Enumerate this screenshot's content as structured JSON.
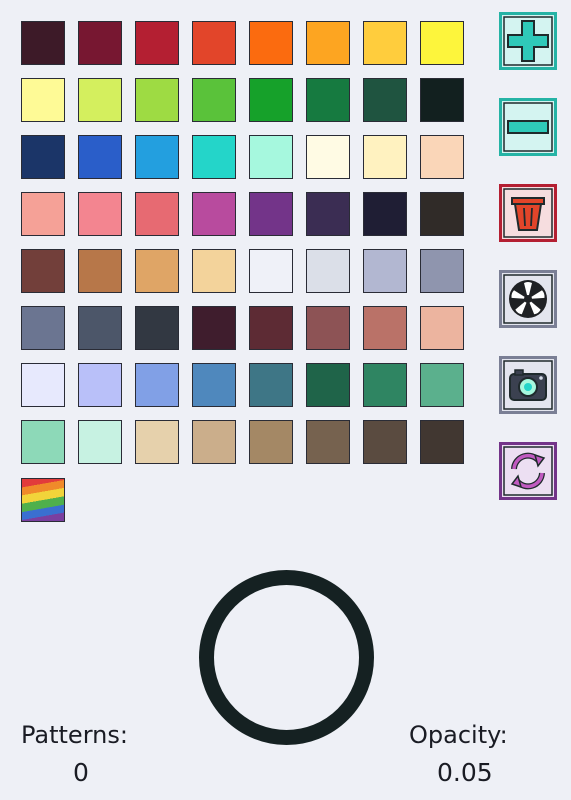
{
  "palette": {
    "colors": [
      "#3d1a28",
      "#771731",
      "#b41f32",
      "#e2452a",
      "#fb6b0f",
      "#fda521",
      "#ffcd3d",
      "#fdf53c",
      "#fefa96",
      "#d4ef5e",
      "#9edb43",
      "#5ac23a",
      "#16a12a",
      "#167a40",
      "#1f5440",
      "#12201f",
      "#1b3568",
      "#2a5ec9",
      "#239fdf",
      "#24d5c9",
      "#a6f8de",
      "#fffbe4",
      "#fff2c0",
      "#fad6b8",
      "#f5a197",
      "#f38590",
      "#e76a72",
      "#b84b9e",
      "#733489",
      "#3b2d53",
      "#1f1e34",
      "#302b28",
      "#723f3a",
      "#b77749",
      "#dfa566",
      "#f3d39b",
      "#eff1f8",
      "#dbdfe8",
      "#b2b7d1",
      "#8f95ae",
      "#6b7591",
      "#4c5669",
      "#323842",
      "#3f1d2d",
      "#5d2b34",
      "#8d5355",
      "#ba7268",
      "#ecb49f",
      "#e7e9fd",
      "#b9c0f9",
      "#81a0e6",
      "#4f88bd",
      "#3e7686",
      "#1f6449",
      "#2f8562",
      "#5bb08d",
      "#8dd9b8",
      "#c7f2e2",
      "#e6d1ac",
      "#cbae8b",
      "#a48865",
      "#76624f",
      "#5a4b40",
      "#413731"
    ],
    "rainbow_label": "rainbow-pattern"
  },
  "tools": [
    {
      "name": "add",
      "color": "#2fc9b9"
    },
    {
      "name": "remove",
      "color": "#2fc9b9"
    },
    {
      "name": "delete",
      "color": "#b41f32"
    },
    {
      "name": "fan",
      "color": "#7a7f95"
    },
    {
      "name": "camera",
      "color": "#7a7f95"
    },
    {
      "name": "refresh",
      "color": "#733489"
    }
  ],
  "preview": {
    "ring_color": "#152122"
  },
  "stats": {
    "patterns_label": "Patterns:",
    "patterns_value": "0",
    "opacity_label": "Opacity:",
    "opacity_value": "0.05"
  }
}
